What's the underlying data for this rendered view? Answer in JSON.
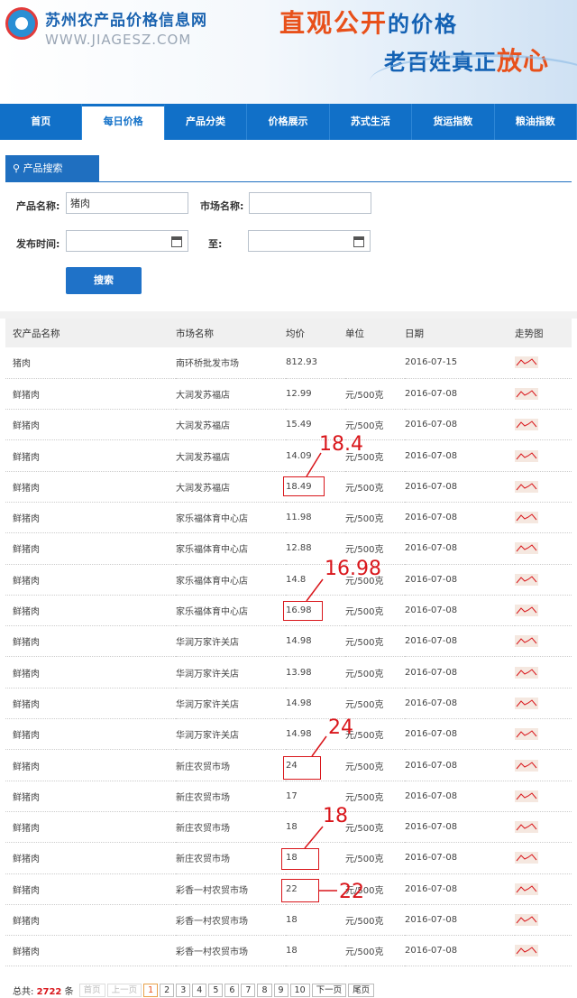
{
  "header": {
    "site_name": "苏州农产品价格信息网",
    "site_url": "WWW.JIAGESZ.COM",
    "slogan1_a": "直观公开",
    "slogan1_b": "的价格",
    "slogan2_a": "老百姓真正",
    "slogan2_b": "放心"
  },
  "nav": [
    "首页",
    "每日价格",
    "产品分类",
    "价格展示",
    "苏式生活",
    "货运指数",
    "粮油指数"
  ],
  "search": {
    "tab_label": "产品搜索",
    "product_label": "产品名称:",
    "product_value": "猪肉",
    "market_label": "市场名称:",
    "market_value": "",
    "date_label": "发布时间:",
    "to_label": "至:",
    "button": "搜索"
  },
  "table": {
    "headers": [
      "农产品名称",
      "市场名称",
      "均价",
      "单位",
      "日期",
      "走势图"
    ],
    "rows": [
      [
        "猪肉",
        "南环桥批发市场",
        "812.93",
        "",
        "2016-07-15"
      ],
      [
        "鲜猪肉",
        "大润发苏福店",
        "12.99",
        "元/500克",
        "2016-07-08"
      ],
      [
        "鲜猪肉",
        "大润发苏福店",
        "15.49",
        "元/500克",
        "2016-07-08"
      ],
      [
        "鲜猪肉",
        "大润发苏福店",
        "14.09",
        "元/500克",
        "2016-07-08"
      ],
      [
        "鲜猪肉",
        "大润发苏福店",
        "18.49",
        "元/500克",
        "2016-07-08"
      ],
      [
        "鲜猪肉",
        "家乐福体育中心店",
        "11.98",
        "元/500克",
        "2016-07-08"
      ],
      [
        "鲜猪肉",
        "家乐福体育中心店",
        "12.88",
        "元/500克",
        "2016-07-08"
      ],
      [
        "鲜猪肉",
        "家乐福体育中心店",
        "14.8",
        "元/500克",
        "2016-07-08"
      ],
      [
        "鲜猪肉",
        "家乐福体育中心店",
        "16.98",
        "元/500克",
        "2016-07-08"
      ],
      [
        "鲜猪肉",
        "华润万家许关店",
        "14.98",
        "元/500克",
        "2016-07-08"
      ],
      [
        "鲜猪肉",
        "华润万家许关店",
        "13.98",
        "元/500克",
        "2016-07-08"
      ],
      [
        "鲜猪肉",
        "华润万家许关店",
        "14.98",
        "元/500克",
        "2016-07-08"
      ],
      [
        "鲜猪肉",
        "华润万家许关店",
        "14.98",
        "元/500克",
        "2016-07-08"
      ],
      [
        "鲜猪肉",
        "新庄农贸市场",
        "24",
        "元/500克",
        "2016-07-08"
      ],
      [
        "鲜猪肉",
        "新庄农贸市场",
        "17",
        "元/500克",
        "2016-07-08"
      ],
      [
        "鲜猪肉",
        "新庄农贸市场",
        "18",
        "元/500克",
        "2016-07-08"
      ],
      [
        "鲜猪肉",
        "新庄农贸市场",
        "18",
        "元/500克",
        "2016-07-08"
      ],
      [
        "鲜猪肉",
        "彩香一村农贸市场",
        "22",
        "元/500克",
        "2016-07-08"
      ],
      [
        "鲜猪肉",
        "彩香一村农贸市场",
        "18",
        "元/500克",
        "2016-07-08"
      ],
      [
        "鲜猪肉",
        "彩香一村农贸市场",
        "18",
        "元/500克",
        "2016-07-08"
      ]
    ]
  },
  "annotations": [
    "18.4",
    "16.98",
    "24",
    "18",
    "22"
  ],
  "pager": {
    "total_label": "总共:",
    "total_count": "2722",
    "total_unit": "条",
    "first": "首页",
    "prev": "上一页",
    "pages": [
      "1",
      "2",
      "3",
      "4",
      "5",
      "6",
      "7",
      "8",
      "9",
      "10"
    ],
    "next": "下一页",
    "last": "尾页"
  },
  "colors": {
    "nav": "#1170c8",
    "accent": "#d9161b",
    "slogan": "#e8501a"
  }
}
